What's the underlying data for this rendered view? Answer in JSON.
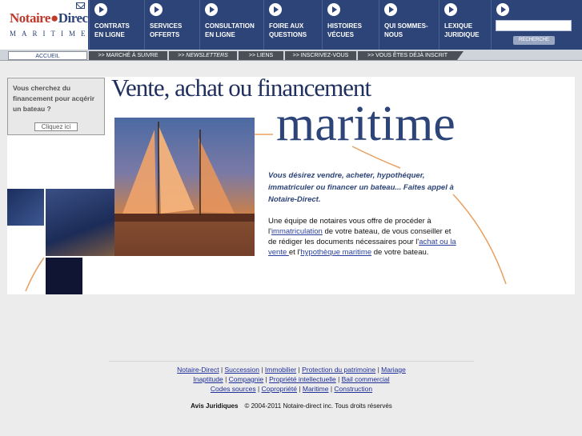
{
  "logo": {
    "brand_a": "Notaire",
    "brand_b": "Direct",
    "subtitle": "MARITIME"
  },
  "nav": [
    {
      "label": "CONTRATS\nEN LIGNE"
    },
    {
      "label": "SERVICES\nOFFERTS"
    },
    {
      "label": "CONSULTATION\nEN LIGNE"
    },
    {
      "label": "FOIRE AUX\nQUESTIONS"
    },
    {
      "label": "HISTOIRES\nVÉCUES"
    },
    {
      "label": "QUI SOMMES-\nNOUS"
    },
    {
      "label": "LEXIQUE\nJURIDIQUE"
    }
  ],
  "search": {
    "button": "RECHERCHE"
  },
  "subnav": [
    {
      "label": "ACCUEIL"
    },
    {
      "label": ">> MARCHÉ À SUIVRE"
    },
    {
      "label": ">> NEWSLETTERS"
    },
    {
      "label": ">> LIENS"
    },
    {
      "label": ">> INSCRIVEZ-VOUS"
    },
    {
      "label": ">> VOUS ÊTES DÉJÀ INSCRIT"
    }
  ],
  "sidebox": {
    "question": "Vous cherchez du financement pour acqérir un bateau ?",
    "cta": "Cliquez ici"
  },
  "hero": {
    "title_line1": "Vente, achat ou financement",
    "title_line2": "maritime"
  },
  "intro": "Vous désirez vendre, acheter, hypothéquer, immatriculer ou financer un bateau... Faites appel à Notaire-Direct.",
  "body": {
    "p1": "Une équipe de notaires vous offre de procéder à l'",
    "link1": "immatriculation",
    "p2": " de votre bateau, de vous conseiller et de rédiger les documents nécessaires pour l'",
    "link2": "achat ou la vente ",
    "p3": "et l'",
    "link3": "hypothèque maritime",
    "p4": " de votre bateau."
  },
  "footer": {
    "links": [
      "Notaire-Direct",
      "Succession",
      "Immobilier",
      "Protection du patrimoine",
      "Mariage",
      "Inaptitude",
      "Compagnie",
      "Propriété intellectuelle",
      "Bail commercial",
      "Codes sources",
      "Copropriété",
      "Maritime",
      "Construction"
    ],
    "legal": "Avis Juridiques",
    "copyright": "© 2004-2011 Notaire-direct inc. Tous droits réservés"
  },
  "colors": {
    "nav_bg": "#2d4478",
    "brand_red": "#c0392b",
    "accent_orange": "#e8a060",
    "link": "#2a3fa0"
  }
}
